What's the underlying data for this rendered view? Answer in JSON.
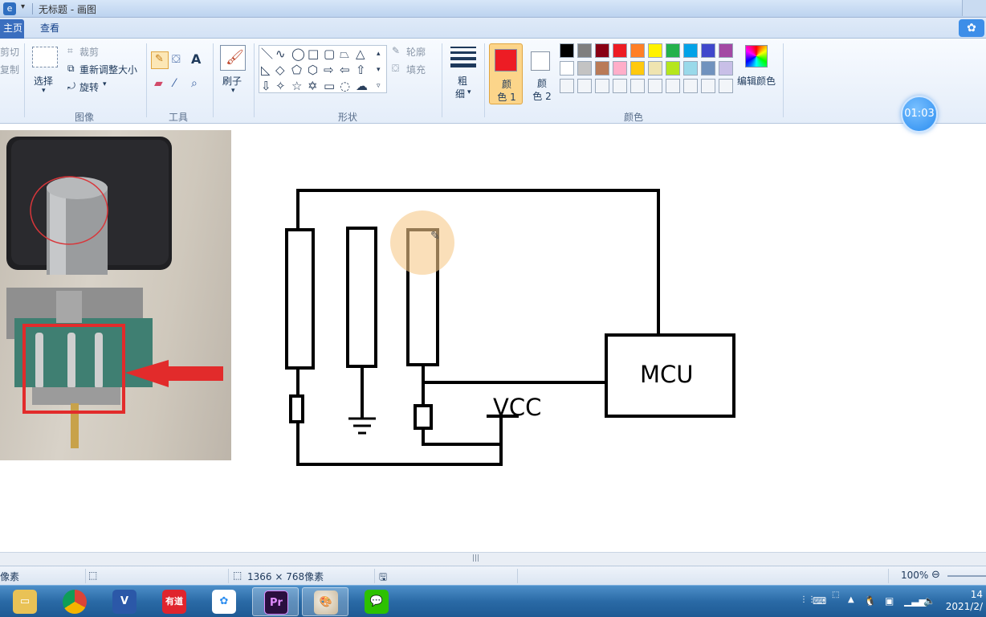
{
  "titlebar": {
    "title": "无标题 - 画图"
  },
  "tabs": {
    "home": "主页",
    "view": "查看"
  },
  "ribbon": {
    "clipboard": {
      "cut": "剪切",
      "copy": "复制"
    },
    "image": {
      "select": "选择",
      "crop": "裁剪",
      "resize": "重新调整大小",
      "rotate": "旋转",
      "group": "图像"
    },
    "tools": {
      "group": "工具"
    },
    "brushes": {
      "label": "刷子"
    },
    "shapes": {
      "outline": "轮廓",
      "fill": "填充",
      "group": "形状"
    },
    "size": {
      "label_line1": "粗",
      "label_line2": "细"
    },
    "colors": {
      "color1_line1": "颜",
      "color1_line2": "色 1",
      "color2_line1": "颜",
      "color2_line2": "色 2",
      "edit": "编辑颜色",
      "group": "颜色",
      "color1": "#ed1c24",
      "color2": "#ffffff",
      "palette_row1": [
        "#000000",
        "#7f7f7f",
        "#880015",
        "#ed1c24",
        "#ff7f27",
        "#fff200",
        "#22b14c",
        "#00a2e8",
        "#3f48cc",
        "#a349a4"
      ],
      "palette_row2": [
        "#ffffff",
        "#c3c3c3",
        "#b97a57",
        "#ffaec9",
        "#ffc90e",
        "#efe4b0",
        "#b5e61d",
        "#99d9ea",
        "#7092be",
        "#c8bfe7"
      ]
    }
  },
  "canvas": {
    "labels": {
      "mcu": "MCU",
      "vcc": "VCC"
    }
  },
  "statusbar": {
    "pixel": "像素",
    "dimensions": "1366 × 768像素",
    "zoom": "100%"
  },
  "timer": "01:03",
  "taskbar": {
    "apps": [
      "file-explorer",
      "chrome",
      "v4-app",
      "youdao",
      "baidu-netdisk",
      "premiere",
      "paint",
      "wechat"
    ],
    "youdao_label": "有道",
    "premiere_label": "Pr",
    "v_label": "V",
    "clock_time": "14",
    "clock_date": "2021/2/"
  }
}
